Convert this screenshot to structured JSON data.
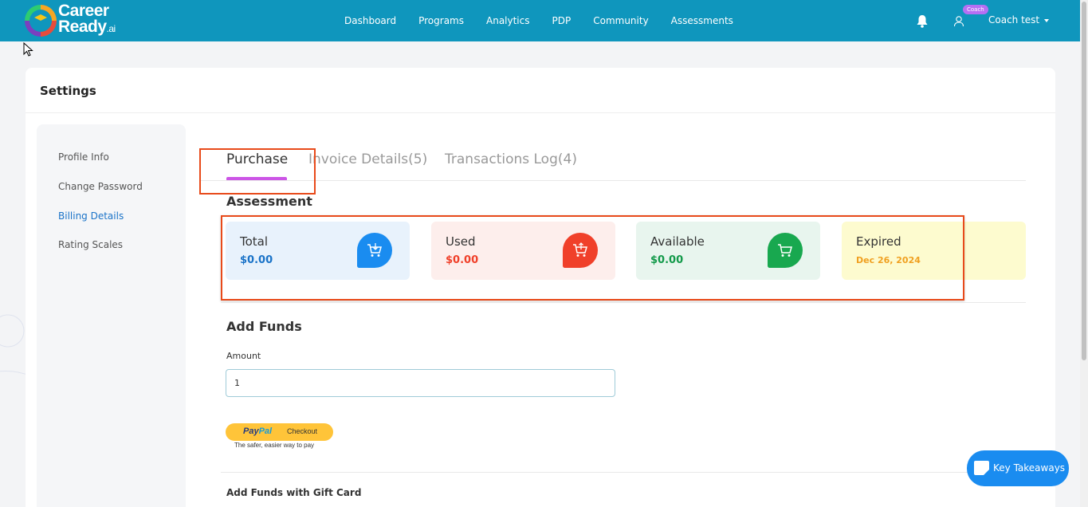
{
  "app": {
    "logo_text": "Career",
    "logo_text2": "Ready",
    "logo_suffix": ".ai"
  },
  "nav": {
    "items": [
      "Dashboard",
      "Programs",
      "Analytics",
      "PDP",
      "Community",
      "Assessments"
    ]
  },
  "user": {
    "role_badge": "Coach",
    "name": "Coach test"
  },
  "page": {
    "title": "Settings"
  },
  "sidebar": {
    "items": [
      {
        "label": "Profile Info"
      },
      {
        "label": "Change Password"
      },
      {
        "label": "Billing Details"
      },
      {
        "label": "Rating Scales"
      }
    ],
    "active": "Billing Details"
  },
  "tabs": [
    {
      "label": "Purchase"
    },
    {
      "label": "Invoice Details(5)"
    },
    {
      "label": "Transactions Log(4)"
    }
  ],
  "assessment": {
    "title": "Assessment",
    "cards": [
      {
        "label": "Total",
        "value": "$0.00",
        "color": "#1a73c8",
        "icon_color": "#1a8cf0",
        "bg": "#e8f2fc",
        "icon": "cart-icon"
      },
      {
        "label": "Used",
        "value": "$0.00",
        "color": "#f0402a",
        "icon_color": "#f0402a",
        "bg": "#fdeeec",
        "icon": "cart-icon"
      },
      {
        "label": "Available",
        "value": "$0.00",
        "color": "#139a4a",
        "icon_color": "#18a84f",
        "bg": "#e8f5ee",
        "icon": "cart-icon"
      },
      {
        "label": "Expired",
        "value": "Dec 26, 2024",
        "color": "#f0a020",
        "bg": "#fdfbcf"
      }
    ]
  },
  "add_funds": {
    "title": "Add Funds",
    "amount_label": "Amount",
    "amount_value": "1",
    "paypal_pay": "Pay",
    "paypal_pal": "Pal",
    "paypal_checkout": "Checkout",
    "paypal_tagline": "The safer, easier way to pay"
  },
  "gift_card": {
    "title": "Add Funds with Gift Card"
  },
  "key_takeaways": {
    "label": "Key Takeaways"
  }
}
